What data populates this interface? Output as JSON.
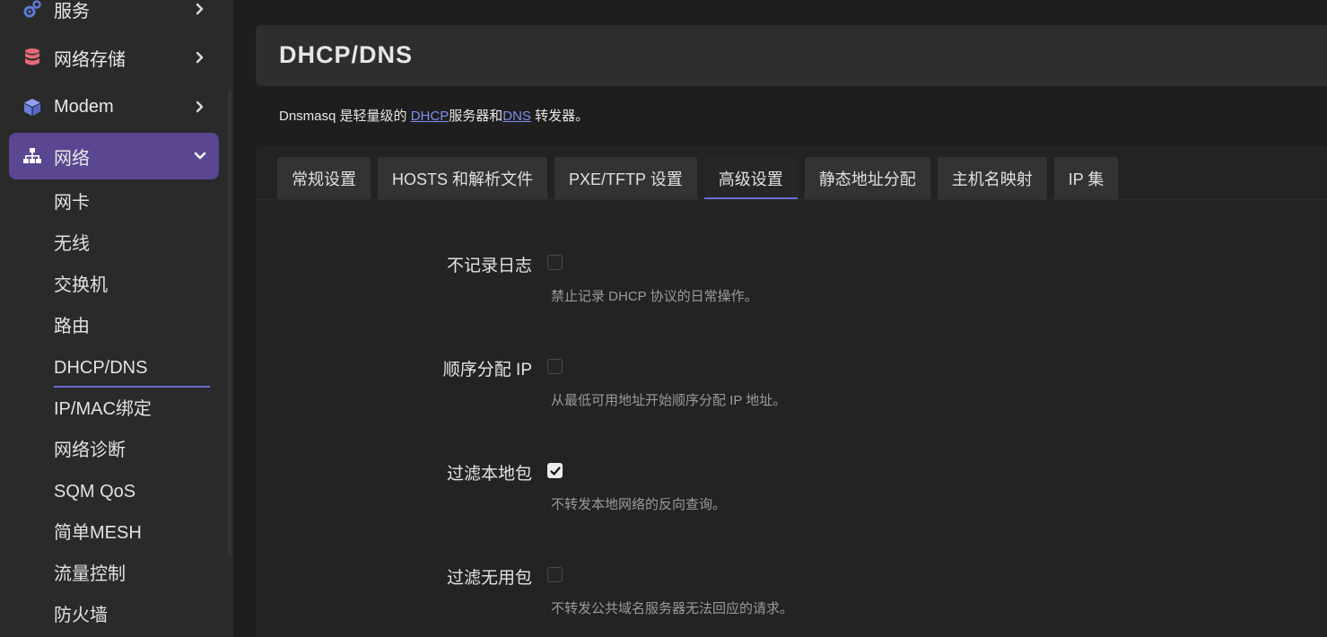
{
  "sidebar": {
    "items": [
      {
        "label": "服务",
        "icon": "gears-icon"
      },
      {
        "label": "网络存储",
        "icon": "database-icon"
      },
      {
        "label": "Modem",
        "icon": "cube-icon"
      },
      {
        "label": "网络",
        "icon": "sitemap-icon",
        "active": true
      }
    ],
    "sub_items": [
      "网卡",
      "无线",
      "交换机",
      "路由",
      "DHCP/DNS",
      "IP/MAC绑定",
      "网络诊断",
      "SQM QoS",
      "简单MESH",
      "流量控制",
      "防火墙"
    ],
    "active_sub": "DHCP/DNS"
  },
  "header": {
    "title": "DHCP/DNS"
  },
  "description": {
    "prefix": "Dnsmasq 是轻量级的 ",
    "link1": "DHCP",
    "middle": "服务器和",
    "link2": "DNS",
    "suffix": " 转发器。"
  },
  "tabs": [
    "常规设置",
    "HOSTS 和解析文件",
    "PXE/TFTP 设置",
    "高级设置",
    "静态地址分配",
    "主机名映射",
    "IP 集"
  ],
  "active_tab": "高级设置",
  "fields": [
    {
      "label": "不记录日志",
      "checked": false,
      "help": "禁止记录 DHCP 协议的日常操作。"
    },
    {
      "label": "顺序分配 IP",
      "checked": false,
      "help": "从最低可用地址开始顺序分配 IP 地址。"
    },
    {
      "label": "过滤本地包",
      "checked": true,
      "help": "不转发本地网络的反向查询。"
    },
    {
      "label": "过滤无用包",
      "checked": false,
      "help": "不转发公共域名服务器无法回应的请求。"
    }
  ],
  "colors": {
    "accent": "#5a4691",
    "underline": "#6a6cd6",
    "link": "#7f8ff0"
  }
}
